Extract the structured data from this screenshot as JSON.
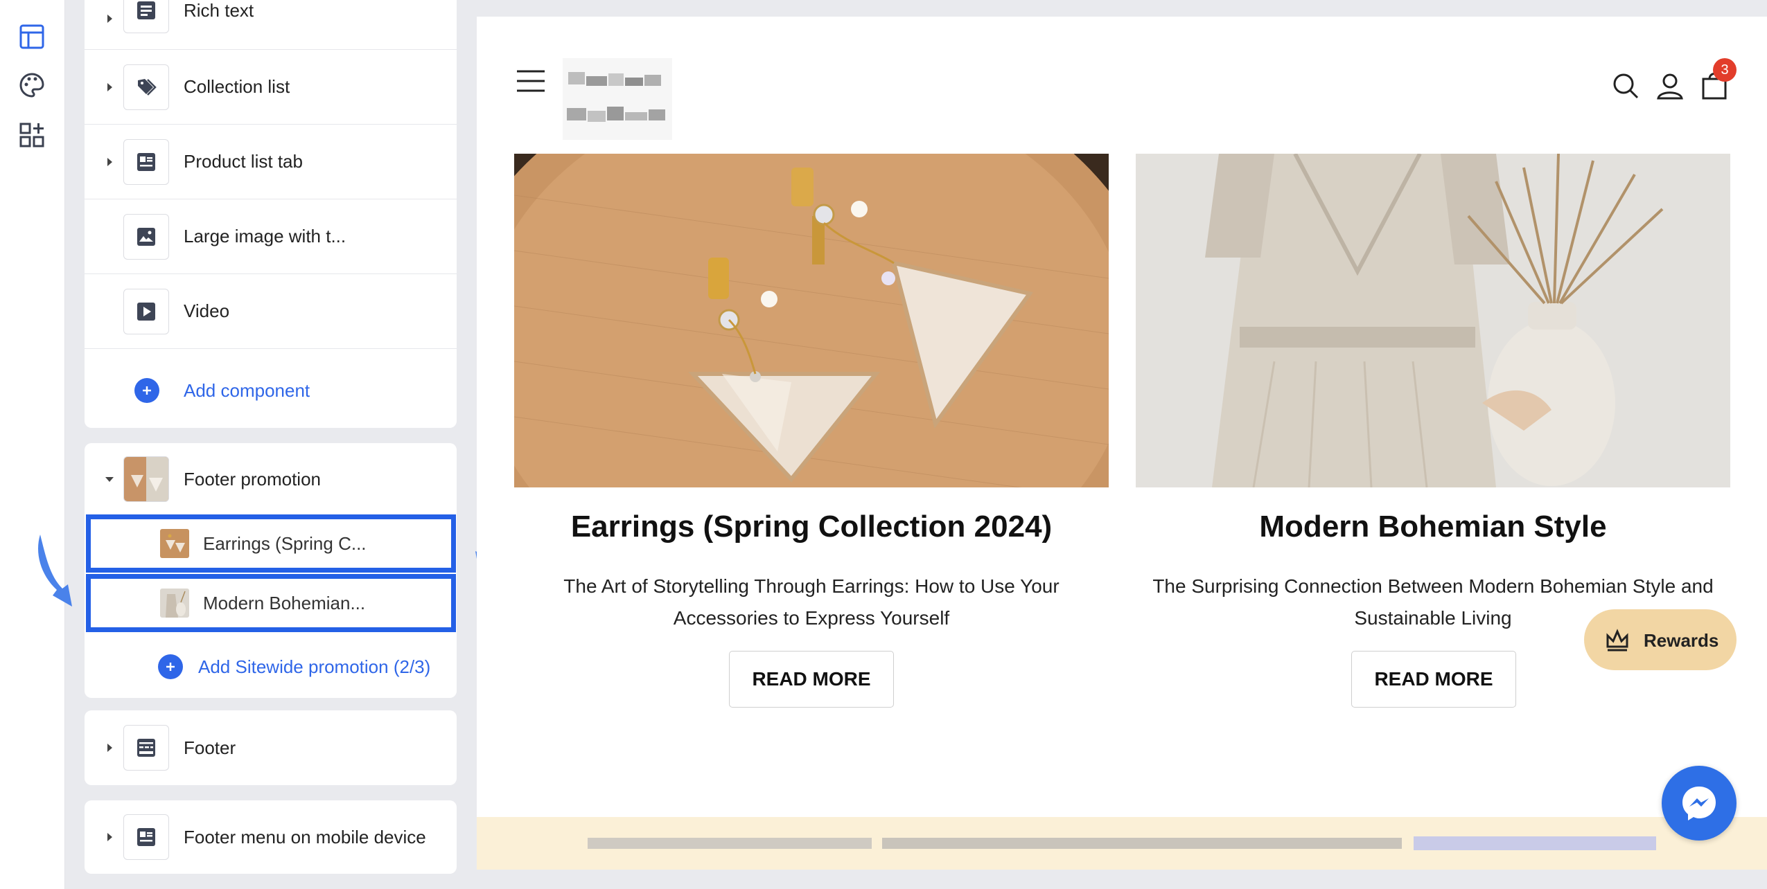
{
  "colors": {
    "accent": "#2f66e8",
    "highlight": "#2460e6",
    "badge": "#e23d2b",
    "rewards_bg": "#f2d6a4",
    "footer_band": "#fbf0d7"
  },
  "rail": {
    "items": [
      {
        "icon": "layout-icon"
      },
      {
        "icon": "palette-icon"
      },
      {
        "icon": "apps-add-icon"
      }
    ]
  },
  "sections": {
    "rich_text": "Rich text",
    "collection_list": "Collection list",
    "product_list_tab": "Product list tab",
    "large_image": "Large image with t...",
    "video": "Video",
    "add_component": "Add component",
    "footer_promotion": "Footer promotion",
    "promo_items": [
      "Earrings (Spring C...",
      "Modern Bohemian..."
    ],
    "add_sitewide": "Add Sitewide promotion (2/3)",
    "footer": "Footer",
    "footer_mobile": "Footer menu on mobile device"
  },
  "preview": {
    "cart_count": "3",
    "cards": [
      {
        "title": "Earrings (Spring Collection 2024)",
        "desc_line1": "The Art of Storytelling Through Earrings: How to Use Your",
        "desc_line2": "Accessories to Express Yourself",
        "button": "READ MORE"
      },
      {
        "title": "Modern Bohemian Style",
        "desc_line1": "The Surprising Connection Between Modern Bohemian Style and",
        "desc_line2": "Sustainable Living",
        "button": "READ MORE"
      }
    ],
    "rewards": "Rewards"
  }
}
